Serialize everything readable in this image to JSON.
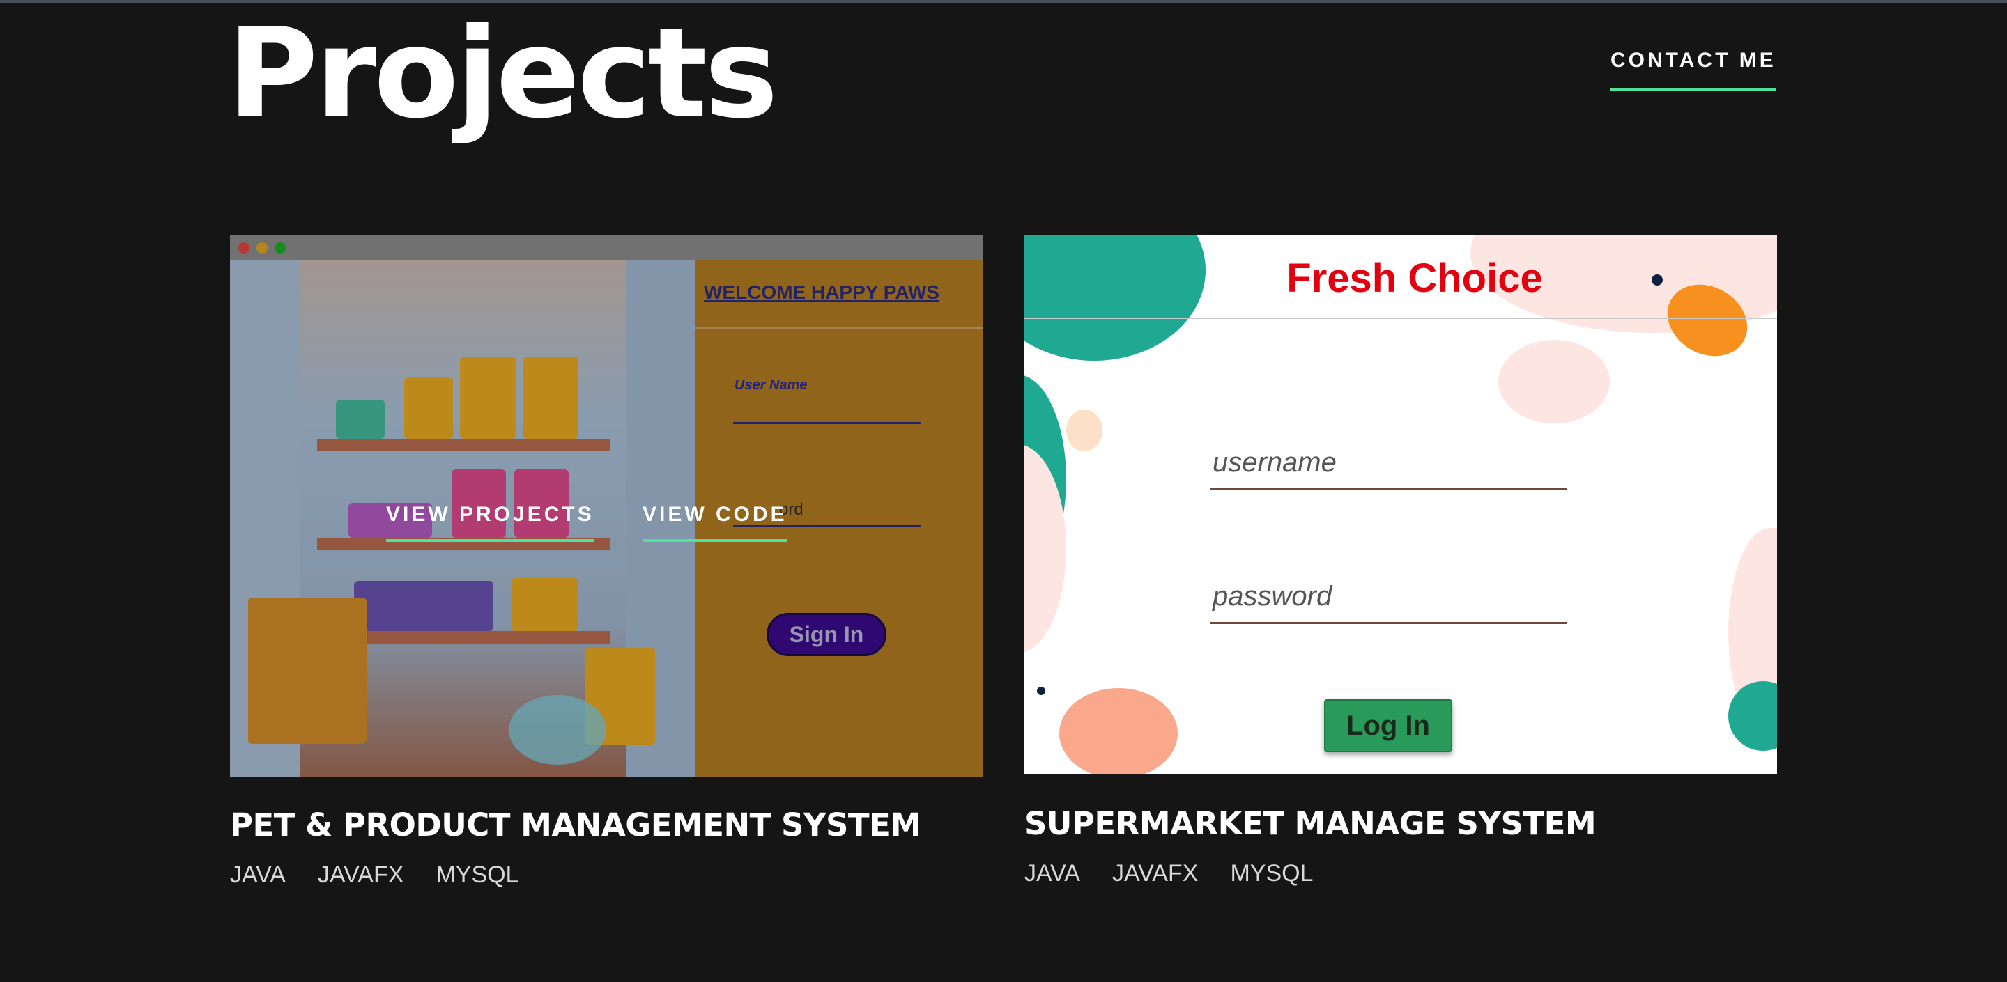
{
  "header": {
    "title": "Projects",
    "contact_label": "CONTACT ME"
  },
  "projects": [
    {
      "title": "PET & PRODUCT MANAGEMENT SYSTEM",
      "tags": [
        "JAVA",
        "JAVAFX",
        "MYSQL"
      ],
      "preview": {
        "welcome": "WELCOME  HAPPY PAWS",
        "username_label": "User Name",
        "password_fragment": "ord",
        "sign_in": "Sign In"
      },
      "overlay": {
        "view_projects": "VIEW PROJECTS",
        "view_code": "VIEW CODE"
      }
    },
    {
      "title": "SUPERMARKET MANAGE SYSTEM",
      "tags": [
        "JAVA",
        "JAVAFX",
        "MYSQL"
      ],
      "preview": {
        "brand": "Fresh Choice",
        "username_placeholder": "username",
        "password_placeholder": "password",
        "login": "Log In"
      }
    }
  ],
  "colors": {
    "background": "#151515",
    "accent": "#4ee1a0",
    "brand_red": "#e3000f",
    "login_green": "#2a9a5a",
    "signin_purple": "#3a0a8a"
  }
}
